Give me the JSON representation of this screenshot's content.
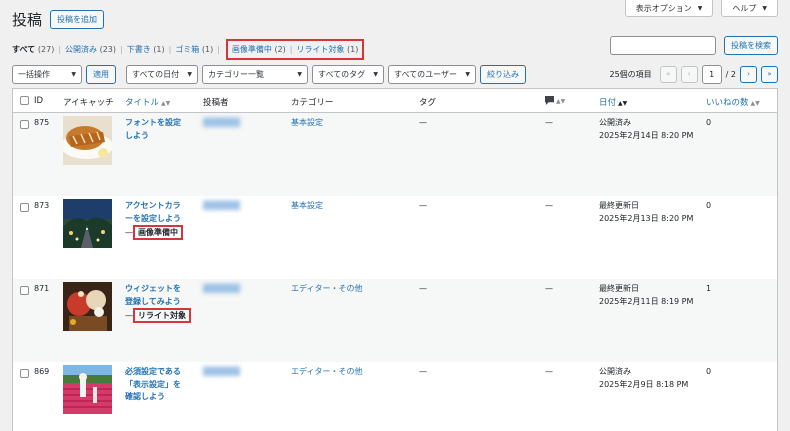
{
  "top_buttons": {
    "screen_options": "表示オプション",
    "help": "ヘルプ"
  },
  "header": {
    "title": "投稿",
    "add_new": "投稿を追加"
  },
  "filters": {
    "all": "すべて",
    "all_count": "(27)",
    "published": "公開済み",
    "published_count": "(23)",
    "draft": "下書き",
    "draft_count": "(1)",
    "trash": "ゴミ箱",
    "trash_count": "(1)",
    "preparing": "画像準備中",
    "preparing_count": "(2)",
    "rewrite": "リライト対象",
    "rewrite_count": "(1)",
    "separator": "|"
  },
  "search": {
    "button": "投稿を検索"
  },
  "tablenav": {
    "bulk_action": "一括操作",
    "apply": "適用",
    "dates": "すべての日付",
    "categories": "カテゴリー一覧",
    "tags": "すべてのタグ",
    "users": "すべてのユーザー",
    "filter": "絞り込み",
    "items": "25個の項目",
    "current_page": "1",
    "total_pages": "/ 2",
    "first": "«",
    "prev": "‹",
    "next": "›",
    "last": "»"
  },
  "columns": {
    "id": "ID",
    "thumbnail": "アイキャッチ",
    "title": "タイトル",
    "author": "投稿者",
    "categories": "カテゴリー",
    "tags": "タグ",
    "date": "日付",
    "likes": "いいねの数"
  },
  "rows": [
    {
      "id": "875",
      "title_l1": "フォントを設定",
      "title_l2": "しよう",
      "title_l3": "",
      "state": "",
      "author": "██████",
      "category": "基本設定",
      "tags": "—",
      "comments": "—",
      "status": "公開済み",
      "datetime": "2025年2月14日 8:20 PM",
      "likes": "0"
    },
    {
      "id": "873",
      "title_l1": "アクセントカラ",
      "title_l2": "ーを設定しよう",
      "title_l3": "—",
      "state": "画像準備中",
      "author": "██████",
      "category": "基本設定",
      "tags": "—",
      "comments": "—",
      "status": "最終更新日",
      "datetime": "2025年2月13日 8:20 PM",
      "likes": "0"
    },
    {
      "id": "871",
      "title_l1": "ウィジェットを",
      "title_l2": "登録してみよう",
      "title_l3": "—",
      "state": "リライト対象",
      "author": "██████",
      "category": "エディター・その他",
      "tags": "—",
      "comments": "—",
      "status": "最終更新日",
      "datetime": "2025年2月11日 8:19 PM",
      "likes": "1"
    },
    {
      "id": "869",
      "title_l1": "必須設定である",
      "title_l2": "「表示設定」を",
      "title_l3": "確認しよう",
      "state": "",
      "author": "██████",
      "category": "エディター・その他",
      "tags": "—",
      "comments": "—",
      "status": "公開済み",
      "datetime": "2025年2月9日 8:18 PM",
      "likes": "0"
    }
  ],
  "colors": {
    "accent": "#2271b1",
    "highlight": "#d63638",
    "bg": "#f0f0f1"
  },
  "icons": {
    "comments": "comment-bubble-icon",
    "sort": "sort-icon",
    "date_sort": "sort-desc-icon"
  }
}
